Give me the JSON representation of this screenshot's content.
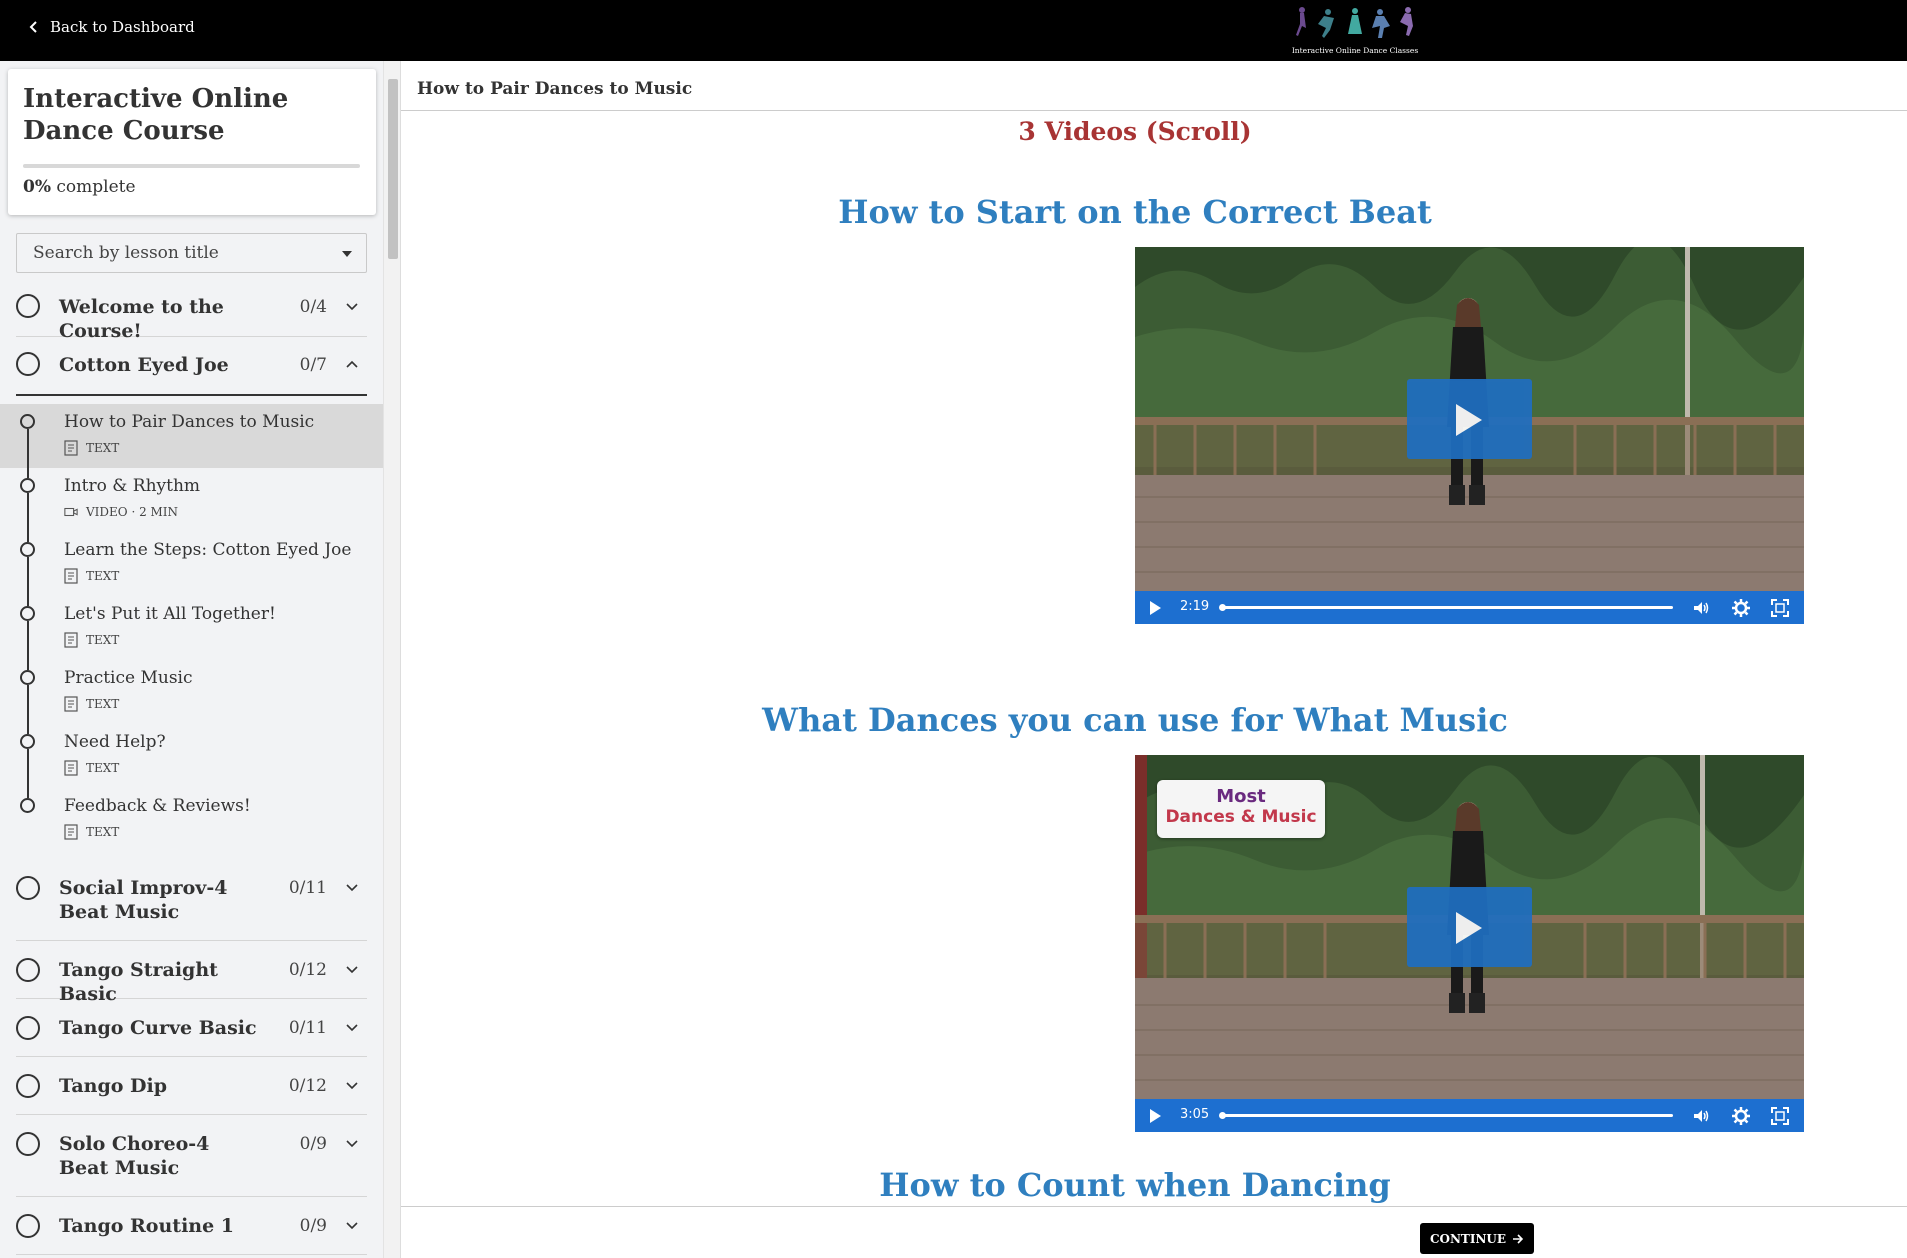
{
  "topbar": {
    "back_label": "Back to Dashboard",
    "logo_text": "Interactive Online Dance Classes"
  },
  "sidebar": {
    "course_title": "Interactive Online Dance Course",
    "progress_percent": "0%",
    "progress_suffix": " complete",
    "progress_value": 0,
    "search_placeholder": "Search by lesson title",
    "chapters": [
      {
        "title": "Welcome to the Course!",
        "count": "0/4",
        "expanded": false
      },
      {
        "title": "Cotton Eyed Joe",
        "count": "0/7",
        "expanded": true
      },
      {
        "title": "Social Improv-4 Beat Music",
        "count": "0/11",
        "expanded": false
      },
      {
        "title": "Tango Straight Basic",
        "count": "0/12",
        "expanded": false
      },
      {
        "title": "Tango Curve Basic",
        "count": "0/11",
        "expanded": false
      },
      {
        "title": "Tango Dip",
        "count": "0/12",
        "expanded": false
      },
      {
        "title": "Solo Choreo-4 Beat Music",
        "count": "0/9",
        "expanded": false
      },
      {
        "title": "Tango Routine 1",
        "count": "0/9",
        "expanded": false
      }
    ],
    "lessons": [
      {
        "title": "How to Pair Dances to Music",
        "type": "TEXT",
        "icon": "document-icon",
        "active": true
      },
      {
        "title": "Intro & Rhythm",
        "type": "VIDEO · 2 MIN",
        "icon": "video-icon",
        "active": false
      },
      {
        "title": "Learn the Steps: Cotton Eyed Joe",
        "type": "TEXT",
        "icon": "document-icon",
        "active": false
      },
      {
        "title": "Let's Put it All Together!",
        "type": "TEXT",
        "icon": "document-icon",
        "active": false
      },
      {
        "title": "Practice Music",
        "type": "TEXT",
        "icon": "document-icon",
        "active": false
      },
      {
        "title": "Need Help?",
        "type": "TEXT",
        "icon": "document-icon",
        "active": false
      },
      {
        "title": "Feedback & Reviews!",
        "type": "TEXT",
        "icon": "document-icon",
        "active": false
      }
    ]
  },
  "main": {
    "breadcrumb": "How to Pair Dances to Music",
    "videos_note": "3 Videos (Scroll)",
    "videos": [
      {
        "title": "How to Start on the Correct Beat",
        "duration": "2:19",
        "caption": null
      },
      {
        "title": "What Dances you can use for What Music",
        "duration": "3:05",
        "caption": {
          "line1": "Most",
          "line2": "Dances & Music"
        }
      },
      {
        "title": "How to Count when Dancing"
      }
    ],
    "continue_label": "CONTINUE"
  },
  "colors": {
    "topbar": "#000000",
    "sidebar_bg": "#f2f3f5",
    "video_title": "#2f7fbf",
    "videos_note": "#a83434",
    "player_controls": "#1d6fd0",
    "continue_button": "#000000"
  }
}
